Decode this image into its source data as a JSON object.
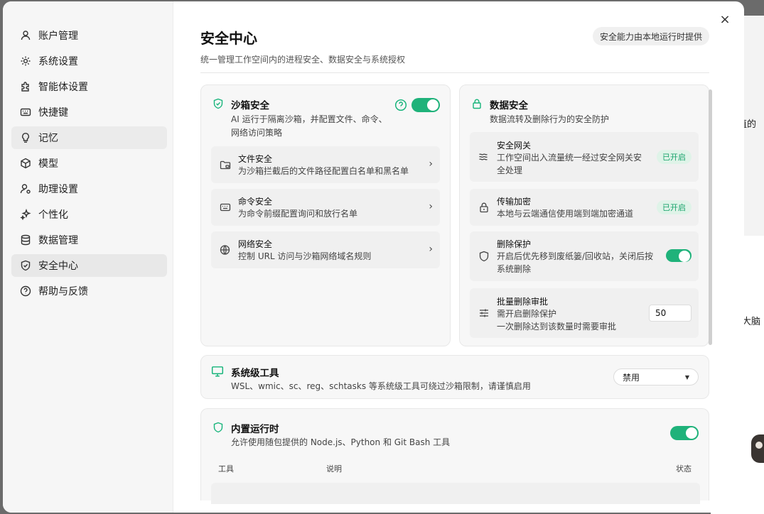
{
  "background": {
    "snippet_1": "值的",
    "snippet_2": "大脑",
    "snippet_0": "："
  },
  "sidebar": {
    "items": [
      {
        "label": "账户管理",
        "icon": "user-icon"
      },
      {
        "label": "系统设置",
        "icon": "gear-icon"
      },
      {
        "label": "智能体设置",
        "icon": "puzzle-icon"
      },
      {
        "label": "快捷键",
        "icon": "keyboard-icon"
      },
      {
        "label": "记忆",
        "icon": "lightbulb-icon"
      },
      {
        "label": "模型",
        "icon": "cube-icon"
      },
      {
        "label": "助理设置",
        "icon": "user-gear-icon"
      },
      {
        "label": "个性化",
        "icon": "sparkle-icon"
      },
      {
        "label": "数据管理",
        "icon": "database-icon"
      },
      {
        "label": "安全中心",
        "icon": "shield-icon"
      },
      {
        "label": "帮助与反馈",
        "icon": "help-circle-icon"
      }
    ],
    "active_index": 9
  },
  "header": {
    "title": "安全中心",
    "subtitle": "统一管理工作空间内的进程安全、数据安全与系统授权",
    "note": "安全能力由本地运行时提供",
    "close": "×"
  },
  "sandbox": {
    "title": "沙箱安全",
    "desc_line1": "AI 运行于隔离沙箱，并配置文件、命令、",
    "desc_line2": "网络访问策略",
    "enabled": true,
    "rows": [
      {
        "title": "文件安全",
        "desc": "为沙箱拦截后的文件路径配置白名单和黑名单"
      },
      {
        "title": "命令安全",
        "desc": "为命令前缀配置询问和放行名单"
      },
      {
        "title": "网络安全",
        "desc": "控制 URL 访问与沙箱网络域名规则"
      }
    ]
  },
  "data_security": {
    "title": "数据安全",
    "desc": "数据流转及删除行为的安全防护",
    "gateway": {
      "title": "安全网关",
      "desc_line1": "工作空间出入流量统一经过安全网关安",
      "desc_line2": "全处理",
      "badge": "已开启"
    },
    "encryption": {
      "title": "传输加密",
      "desc": "本地与云端通信使用端到端加密通道",
      "badge": "已开启"
    },
    "delete_protect": {
      "title": "删除保护",
      "desc_line1": "开启后优先移到废纸篓/回收站，关闭后按",
      "desc_line2": "系统删除",
      "enabled": true
    },
    "batch_delete": {
      "title": "批量删除审批",
      "desc_line1": "需开启删除保护",
      "desc_line2": "一次删除达到该数量时需要审批",
      "value": "50"
    }
  },
  "system_tools": {
    "title": "系统级工具",
    "desc": "WSL、wmic、sc、reg、schtasks 等系统级工具可绕过沙箱限制，请谨慎启用",
    "select_value": "禁用"
  },
  "runtime": {
    "title": "内置运行时",
    "desc": "允许使用随包提供的 Node.js、Python 和 Git Bash 工具",
    "enabled": true,
    "columns": [
      "工具",
      "说明",
      "状态"
    ]
  },
  "colors": {
    "accent": "#1fb27a",
    "badge_bg": "#dff3e8",
    "badge_text": "#18a36b"
  }
}
